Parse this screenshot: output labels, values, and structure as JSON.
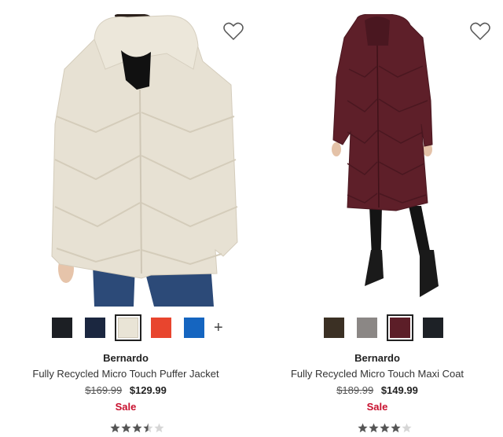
{
  "products": [
    {
      "brand": "Bernardo",
      "name": "Fully Recycled Micro Touch Puffer Jacket",
      "original_price": "$169.99",
      "sale_price": "$129.99",
      "sale_label": "Sale",
      "more_colors": "+",
      "rating": 3.5,
      "swatches": [
        "#1c1f24",
        "#1b2740",
        "#e9e4d6",
        "#e8452e",
        "#1565c0"
      ],
      "selected_swatch": 2,
      "coat_color": "#e6e0d2"
    },
    {
      "brand": "Bernardo",
      "name": "Fully Recycled Micro Touch Maxi Coat",
      "original_price": "$189.99",
      "sale_price": "$149.99",
      "sale_label": "Sale",
      "rating": 4,
      "swatches": [
        "#3b3024",
        "#8b8785",
        "#5c1e28",
        "#1d2126"
      ],
      "selected_swatch": 2,
      "coat_color": "#5e1f29"
    }
  ]
}
